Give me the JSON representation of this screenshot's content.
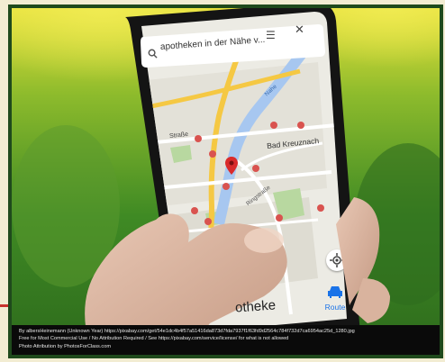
{
  "phone": {
    "search_query": "apotheken in der Nähe v...",
    "menu_icon": "menu-icon",
    "close_icon": "close-icon",
    "search_icon": "search-icon"
  },
  "map": {
    "labels": {
      "bad_kreuznach": "Bad Kreuznach",
      "strasse": "Straße",
      "ringstrasse": "Ringstraße",
      "nahe": "Nahe",
      "partial_bottom": "otheke"
    },
    "pin_color": "#d92b2b"
  },
  "route": {
    "label": "Route",
    "icon": "car-icon",
    "accent": "#1a73e8"
  },
  "caption": {
    "line1": "By  albersHeinemann  (Unknown  Year)  https://pixabay.com/get/54e1dc4b4f57a51416da873d7fda7937f1f63fd9d2564c784f732d7ca6954ac25d_1280.jpg",
    "line2": "Free for Most Commercial Use / No Attribution Required / See https://pixabay.com/service/license/ for what is not allowed",
    "line3": "Photo Attribution by PhotosForClass.com"
  }
}
